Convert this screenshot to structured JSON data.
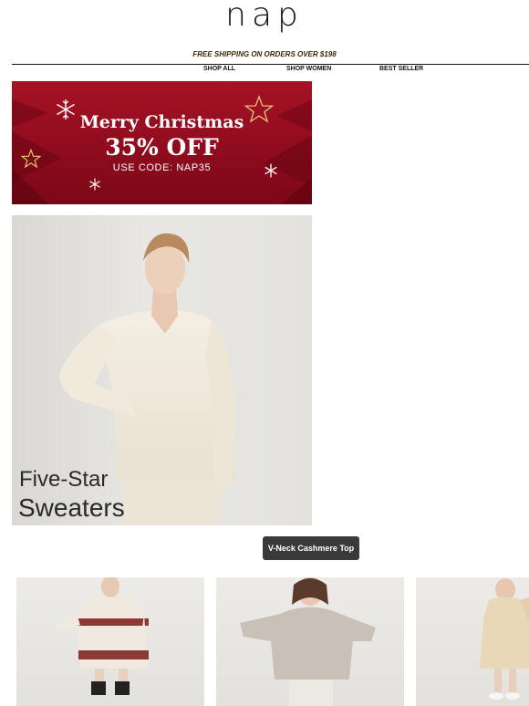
{
  "brand": {
    "logo_text": "nap"
  },
  "announcement": {
    "text": "FREE SHIPPING ON ORDERS OVER $198"
  },
  "nav": {
    "items": [
      {
        "label": "SHOP ALL"
      },
      {
        "label": "SHOP WOMEN"
      },
      {
        "label": "BEST SELLER"
      }
    ]
  },
  "promo": {
    "title": "Merry Christmas",
    "discount": "35% OFF",
    "code_line": "USE CODE:  NAP35",
    "colors": {
      "background": "#9a0e21",
      "star_outline": "#e6c27a"
    }
  },
  "hero": {
    "line1": "Five-Star",
    "line2": "Sweaters"
  },
  "cta": {
    "label": "V-Neck Cashmere Top"
  },
  "products": {
    "items": [
      {
        "image": "fair-isle-sweater-dress-photo"
      },
      {
        "image": "oversized-vneck-sweater-photo"
      },
      {
        "image": "turtleneck-sweater-dress-photo"
      }
    ]
  }
}
